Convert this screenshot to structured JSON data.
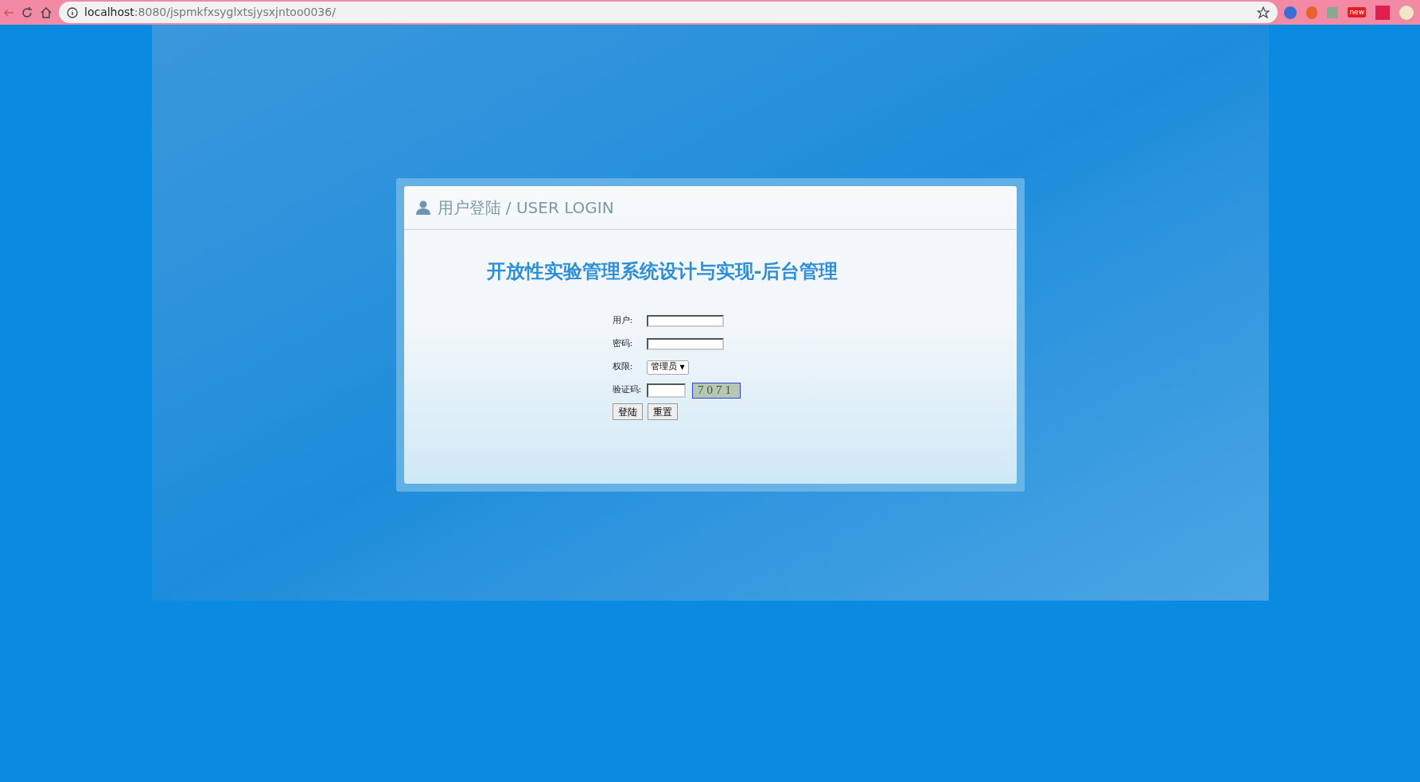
{
  "browser": {
    "url_host": "localhost",
    "url_path": ":8080/jspmkfxsyglxtsjysxjntoo0036/",
    "extension_badge": "new"
  },
  "login": {
    "header": "用户登陆 / USER LOGIN",
    "title": "开放性实验管理系统设计与实现-后台管理",
    "fields": [
      {
        "kind": "text",
        "label": "用户:"
      },
      {
        "kind": "password",
        "label": "密码:"
      },
      {
        "kind": "select",
        "label": "权限:",
        "value": "管理员",
        "arrow": "▼"
      },
      {
        "kind": "captcha",
        "label": "验证码:",
        "captcha": "7071"
      }
    ],
    "buttons": [
      "登陆",
      "重置"
    ]
  }
}
